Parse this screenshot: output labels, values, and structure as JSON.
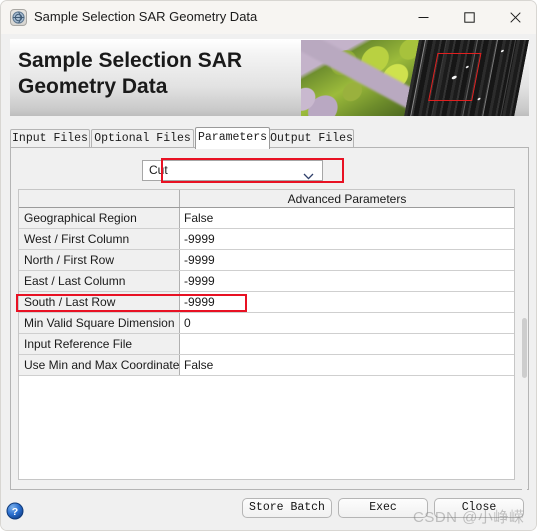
{
  "window": {
    "title": "Sample Selection SAR Geometry Data",
    "icon": "app-globe-icon",
    "controls": {
      "minimize": "minimize-icon",
      "maximize": "maximize-icon",
      "close": "close-icon"
    }
  },
  "banner": {
    "heading": "Sample Selection SAR Geometry Data",
    "image_alt": "aerial-photo-and-sar-image-with-red-selection-box"
  },
  "tabs": [
    {
      "label": "Input Files",
      "active": false
    },
    {
      "label": "Optional Files",
      "active": false
    },
    {
      "label": "Parameters",
      "active": true
    },
    {
      "label": "Output Files",
      "active": false
    }
  ],
  "mode_select": {
    "value": "Cut",
    "placeholder": "Cut",
    "arrow_icon": "chevron-down-icon",
    "highlighted": true
  },
  "table": {
    "header_left": "",
    "header_right": "Advanced Parameters",
    "rows": [
      {
        "label": "Geographical Region",
        "value": "False",
        "highlighted": false
      },
      {
        "label": "West / First Column",
        "value": "-9999",
        "highlighted": false
      },
      {
        "label": "North / First Row",
        "value": "-9999",
        "highlighted": false
      },
      {
        "label": "East / Last Column",
        "value": "-9999",
        "highlighted": false
      },
      {
        "label": "South / Last Row",
        "value": "-9999",
        "highlighted": false
      },
      {
        "label": "Min Valid Square Dimension",
        "value": "0",
        "highlighted": true
      },
      {
        "label": "Input Reference File",
        "value": "",
        "highlighted": false
      },
      {
        "label": "Use Min and Max Coordinates",
        "value": "False",
        "highlighted": false
      }
    ]
  },
  "footer": {
    "help_icon": "help-question-icon",
    "buttons": {
      "store_batch": "Store Batch",
      "exec": "Exec",
      "close": "Close"
    }
  },
  "watermark": {
    "text": "CSDN @小峥嵘"
  },
  "colors": {
    "annotation_red": "#e81123",
    "accent_blue": "#1a64c8",
    "panel_gray": "#f0f0f0",
    "titlebar": "#f7f5f2"
  }
}
